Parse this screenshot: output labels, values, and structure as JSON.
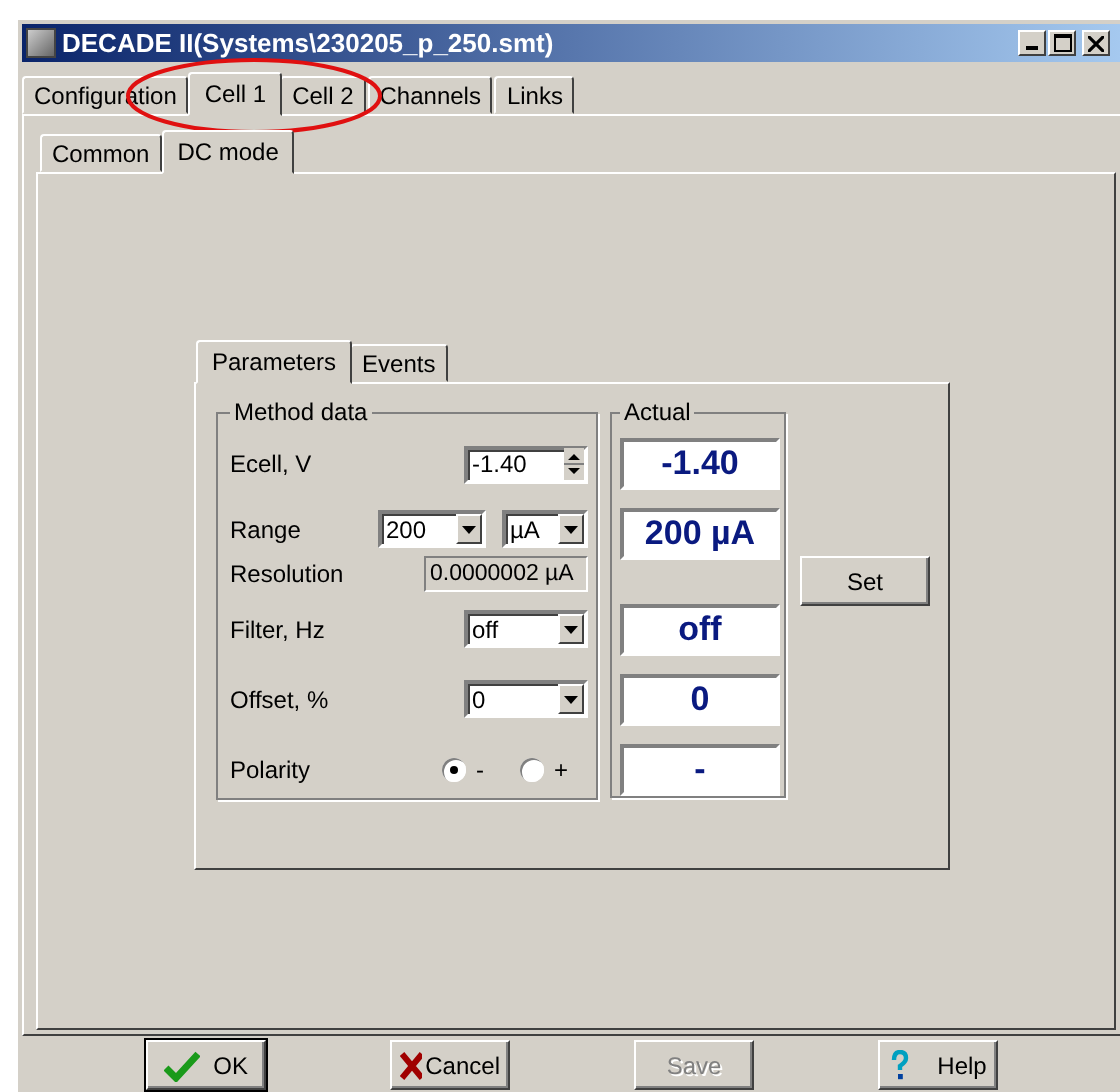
{
  "window": {
    "title": "DECADE II(Systems\\230205_p_250.smt)"
  },
  "tabs": [
    {
      "label": "Configuration",
      "selected": false
    },
    {
      "label": "Cell 1",
      "selected": true
    },
    {
      "label": "Cell 2",
      "selected": false
    },
    {
      "label": "Channels",
      "selected": false
    },
    {
      "label": "Links",
      "selected": false
    }
  ],
  "subtabs": [
    {
      "label": "Common",
      "selected": false
    },
    {
      "label": "DC mode",
      "selected": true
    }
  ],
  "inner_tabs": [
    {
      "label": "Parameters",
      "selected": true
    },
    {
      "label": "Events",
      "selected": false
    }
  ],
  "method_data": {
    "title": "Method data",
    "rows": [
      {
        "kind": "spin",
        "label": "Ecell, V",
        "value": "-1.40"
      },
      {
        "kind": "range",
        "label": "Range",
        "value": "200",
        "unit": "µA"
      },
      {
        "kind": "readonly",
        "label": "Resolution",
        "value": "0.0000002 µA"
      },
      {
        "kind": "combo",
        "label": "Filter, Hz",
        "value": "off"
      },
      {
        "kind": "combo",
        "label": "Offset, %",
        "value": "0"
      },
      {
        "kind": "radio",
        "label": "Polarity",
        "options": [
          {
            "label": "-",
            "selected": true
          },
          {
            "label": "+",
            "selected": false
          }
        ]
      }
    ]
  },
  "actual": {
    "title": "Actual",
    "values": [
      "-1.40",
      "200 µA",
      "off",
      "0",
      "-"
    ]
  },
  "set_button": "Set",
  "buttons": [
    {
      "kind": "ok",
      "label": "OK",
      "disabled": false
    },
    {
      "kind": "cancel",
      "label": "Cancel",
      "disabled": false
    },
    {
      "kind": "save",
      "label": "Save",
      "disabled": true
    },
    {
      "kind": "help",
      "label": "Help",
      "disabled": false
    }
  ]
}
